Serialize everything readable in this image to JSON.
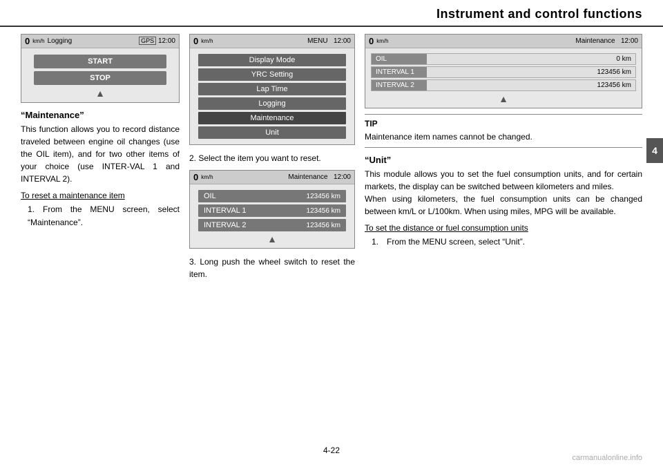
{
  "header": {
    "title": "Instrument and control functions",
    "page_number": "4-22"
  },
  "side_tab": {
    "label": "4"
  },
  "screen1": {
    "speed": "0",
    "speed_unit": "km/h",
    "label": "Logging",
    "gps": "GPS",
    "time": "12:00",
    "btn_start": "START",
    "btn_stop": "STOP"
  },
  "screen2": {
    "speed": "0",
    "speed_unit": "km/h",
    "label": "MENU",
    "time": "12:00",
    "items": [
      "Display Mode",
      "YRC Setting",
      "Lap Time",
      "Logging",
      "Maintenance",
      "Unit"
    ]
  },
  "screen3": {
    "speed": "0",
    "speed_unit": "km/h",
    "label": "Maintenance",
    "time": "12:00",
    "rows": [
      {
        "label": "OIL",
        "value": "123456 km"
      },
      {
        "label": "INTERVAL 1",
        "value": "123456 km"
      },
      {
        "label": "INTERVAL 2",
        "value": "123456 km"
      }
    ]
  },
  "screen4": {
    "speed": "0",
    "speed_unit": "km/h",
    "label": "Maintenance",
    "time": "12:00",
    "rows": [
      {
        "label": "OIL",
        "value": "0 km"
      },
      {
        "label": "INTERVAL 1",
        "value": "123456 km"
      },
      {
        "label": "INTERVAL 2",
        "value": "123456 km"
      }
    ]
  },
  "left_col": {
    "section_title": "“Maintenance”",
    "section_body": "This function allows you to record distance traveled between engine oil changes (use the OIL item), and for two other items of your choice (use INTER-VAL 1 and INTERVAL 2).",
    "reset_title": "To reset a maintenance item",
    "steps": [
      "1. From the MENU screen, select “Maintenance”."
    ]
  },
  "middle_col": {
    "step2": "2. Select the item you want to reset.",
    "step3": "3. Long push the wheel switch to reset the item."
  },
  "right_col": {
    "tip_label": "TIP",
    "tip_text": "Maintenance item names cannot be changed.",
    "unit_title": "“Unit”",
    "unit_body": "This module allows you to set the fuel consumption units, and for certain markets, the display can be switched between kilometers and miles.\nWhen using kilometers, the fuel consumption units can be changed between km/L or L/100km. When using miles, MPG will be available.",
    "distance_title": "To set the distance or fuel consumption units",
    "distance_steps": [
      "1. From the MENU screen, select “Unit”."
    ]
  },
  "watermark": "carmanualonline.info"
}
